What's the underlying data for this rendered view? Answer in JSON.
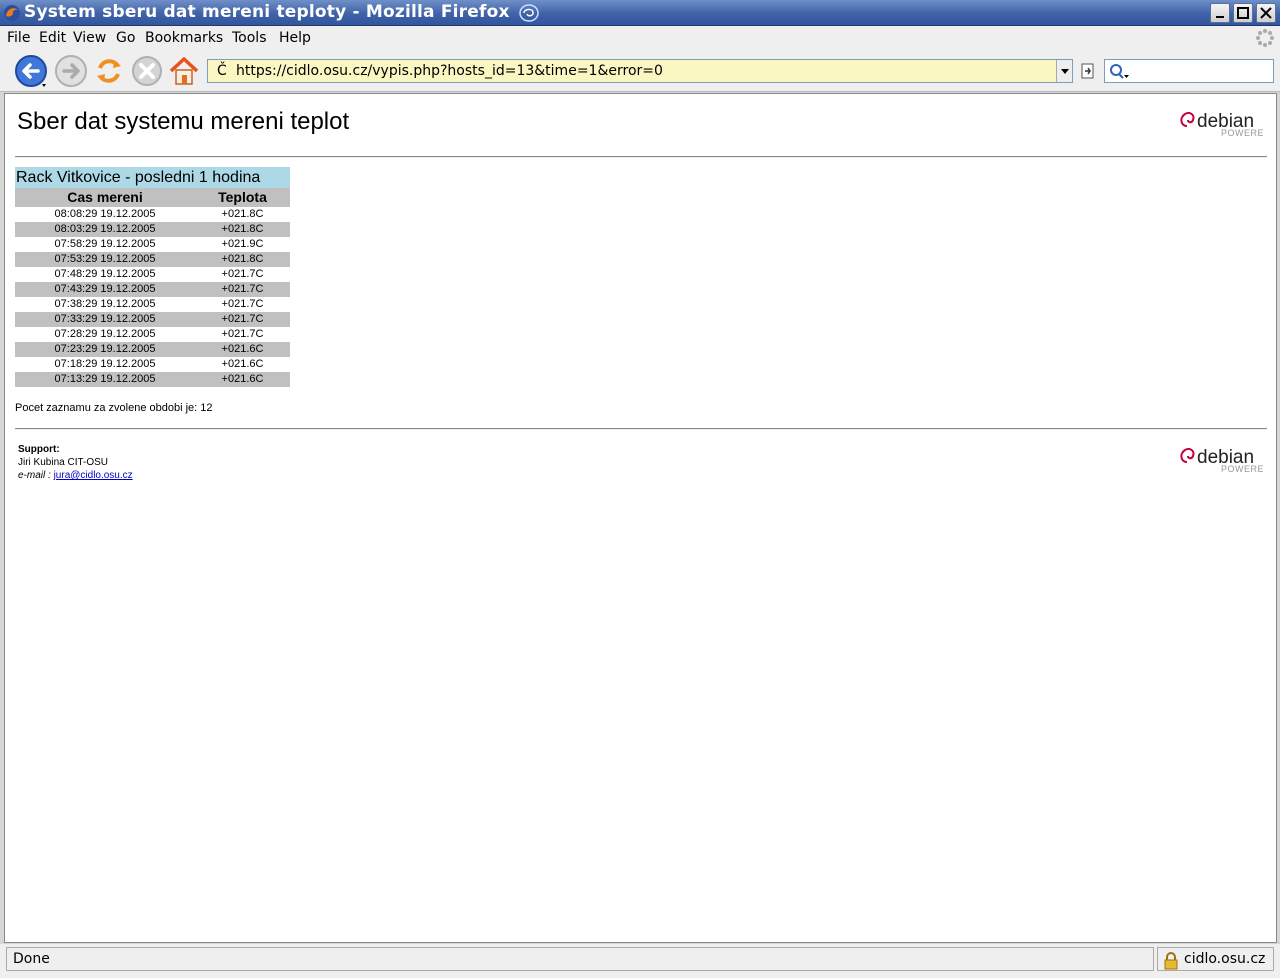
{
  "window": {
    "title": "System sberu dat mereni teploty - Mozilla Firefox"
  },
  "menu": {
    "items": [
      "File",
      "Edit",
      "View",
      "Go",
      "Bookmarks",
      "Tools",
      "Help"
    ]
  },
  "toolbar": {
    "icons": [
      "back-icon",
      "forward-icon",
      "reload-icon",
      "stop-icon",
      "home-icon"
    ],
    "url_prefix_char": "Č",
    "url": "https://cidlo.osu.cz/vypis.php?hosts_id=13&time=1&error=0",
    "search_value": ""
  },
  "page": {
    "title": "Sber dat systemu mereni teplot",
    "logo_word": "debian",
    "logo_sub": "POWERED",
    "table": {
      "title": "Rack Vitkovice - posledni 1 hodina",
      "columns": [
        "Cas mereni",
        "Teplota"
      ],
      "rows": [
        [
          "08:08:29 19.12.2005",
          "+021.8C"
        ],
        [
          "08:03:29 19.12.2005",
          "+021.8C"
        ],
        [
          "07:58:29 19.12.2005",
          "+021.9C"
        ],
        [
          "07:53:29 19.12.2005",
          "+021.8C"
        ],
        [
          "07:48:29 19.12.2005",
          "+021.7C"
        ],
        [
          "07:43:29 19.12.2005",
          "+021.7C"
        ],
        [
          "07:38:29 19.12.2005",
          "+021.7C"
        ],
        [
          "07:33:29 19.12.2005",
          "+021.7C"
        ],
        [
          "07:28:29 19.12.2005",
          "+021.7C"
        ],
        [
          "07:23:29 19.12.2005",
          "+021.6C"
        ],
        [
          "07:18:29 19.12.2005",
          "+021.6C"
        ],
        [
          "07:13:29 19.12.2005",
          "+021.6C"
        ]
      ]
    },
    "count_text": "Pocet zaznamu za zvolene obdobi je: 12",
    "support": {
      "label": "Support:",
      "name": "Jiri Kubina CIT-OSU",
      "email_label": "e-mail :",
      "email": "jura@cidlo.osu.cz"
    }
  },
  "status": {
    "text": "Done",
    "host": "cidlo.osu.cz"
  },
  "colors": {
    "table_title_bg": "#add8e6",
    "row_alt_bg": "#c0c0c0",
    "url_bg": "#fbf7c2",
    "titlebar": "#3f62a8"
  }
}
